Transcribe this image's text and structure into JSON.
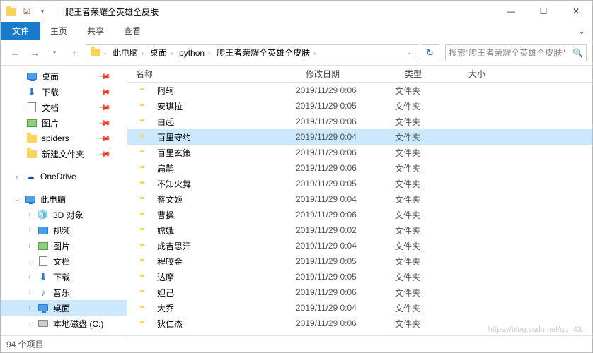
{
  "window": {
    "title": "爬王者荣耀全英雄全皮肤",
    "minimize": "—",
    "maximize": "☐",
    "close": "✕"
  },
  "ribbon": {
    "file": "文件",
    "tabs": [
      "主页",
      "共享",
      "查看"
    ]
  },
  "nav": {
    "crumbs": [
      "此电脑",
      "桌面",
      "python",
      "爬王者荣耀全英雄全皮肤"
    ],
    "search_placeholder": "搜索\"爬王者荣耀全英雄全皮肤\""
  },
  "sidebar": {
    "quick": [
      {
        "label": "桌面",
        "icon": "monitor",
        "pin": true
      },
      {
        "label": "下载",
        "icon": "download",
        "pin": true
      },
      {
        "label": "文档",
        "icon": "doc",
        "pin": true
      },
      {
        "label": "图片",
        "icon": "pic",
        "pin": true
      },
      {
        "label": "spiders",
        "icon": "folder",
        "pin": true
      },
      {
        "label": "新建文件夹",
        "icon": "folder",
        "pin": true
      }
    ],
    "onedrive": "OneDrive",
    "thispc_label": "此电脑",
    "thispc": [
      {
        "label": "3D 对象",
        "icon": "cube"
      },
      {
        "label": "视频",
        "icon": "video"
      },
      {
        "label": "图片",
        "icon": "pic"
      },
      {
        "label": "文档",
        "icon": "doc"
      },
      {
        "label": "下载",
        "icon": "download"
      },
      {
        "label": "音乐",
        "icon": "music"
      },
      {
        "label": "桌面",
        "icon": "monitor",
        "selected": true
      },
      {
        "label": "本地磁盘 (C:)",
        "icon": "drive"
      }
    ]
  },
  "columns": {
    "name": "名称",
    "date": "修改日期",
    "type": "类型",
    "size": "大小"
  },
  "files": [
    {
      "name": "阿轲",
      "date": "2019/11/29 0:06",
      "type": "文件夹"
    },
    {
      "name": "安琪拉",
      "date": "2019/11/29 0:05",
      "type": "文件夹"
    },
    {
      "name": "白起",
      "date": "2019/11/29 0:06",
      "type": "文件夹"
    },
    {
      "name": "百里守约",
      "date": "2019/11/29 0:04",
      "type": "文件夹",
      "selected": true
    },
    {
      "name": "百里玄策",
      "date": "2019/11/29 0:06",
      "type": "文件夹"
    },
    {
      "name": "扁鹊",
      "date": "2019/11/29 0:06",
      "type": "文件夹"
    },
    {
      "name": "不知火舞",
      "date": "2019/11/29 0:05",
      "type": "文件夹"
    },
    {
      "name": "蔡文姬",
      "date": "2019/11/29 0:04",
      "type": "文件夹"
    },
    {
      "name": "曹操",
      "date": "2019/11/29 0:06",
      "type": "文件夹"
    },
    {
      "name": "嫦娥",
      "date": "2019/11/29 0:02",
      "type": "文件夹"
    },
    {
      "name": "成吉思汗",
      "date": "2019/11/29 0:04",
      "type": "文件夹"
    },
    {
      "name": "程咬金",
      "date": "2019/11/29 0:05",
      "type": "文件夹"
    },
    {
      "name": "达摩",
      "date": "2019/11/29 0:05",
      "type": "文件夹"
    },
    {
      "name": "妲己",
      "date": "2019/11/29 0:06",
      "type": "文件夹"
    },
    {
      "name": "大乔",
      "date": "2019/11/29 0:04",
      "type": "文件夹"
    },
    {
      "name": "狄仁杰",
      "date": "2019/11/29 0:06",
      "type": "文件夹"
    }
  ],
  "status": {
    "count": "94 个项目"
  },
  "watermark": "https://blog.csdn.net/qq_43..."
}
